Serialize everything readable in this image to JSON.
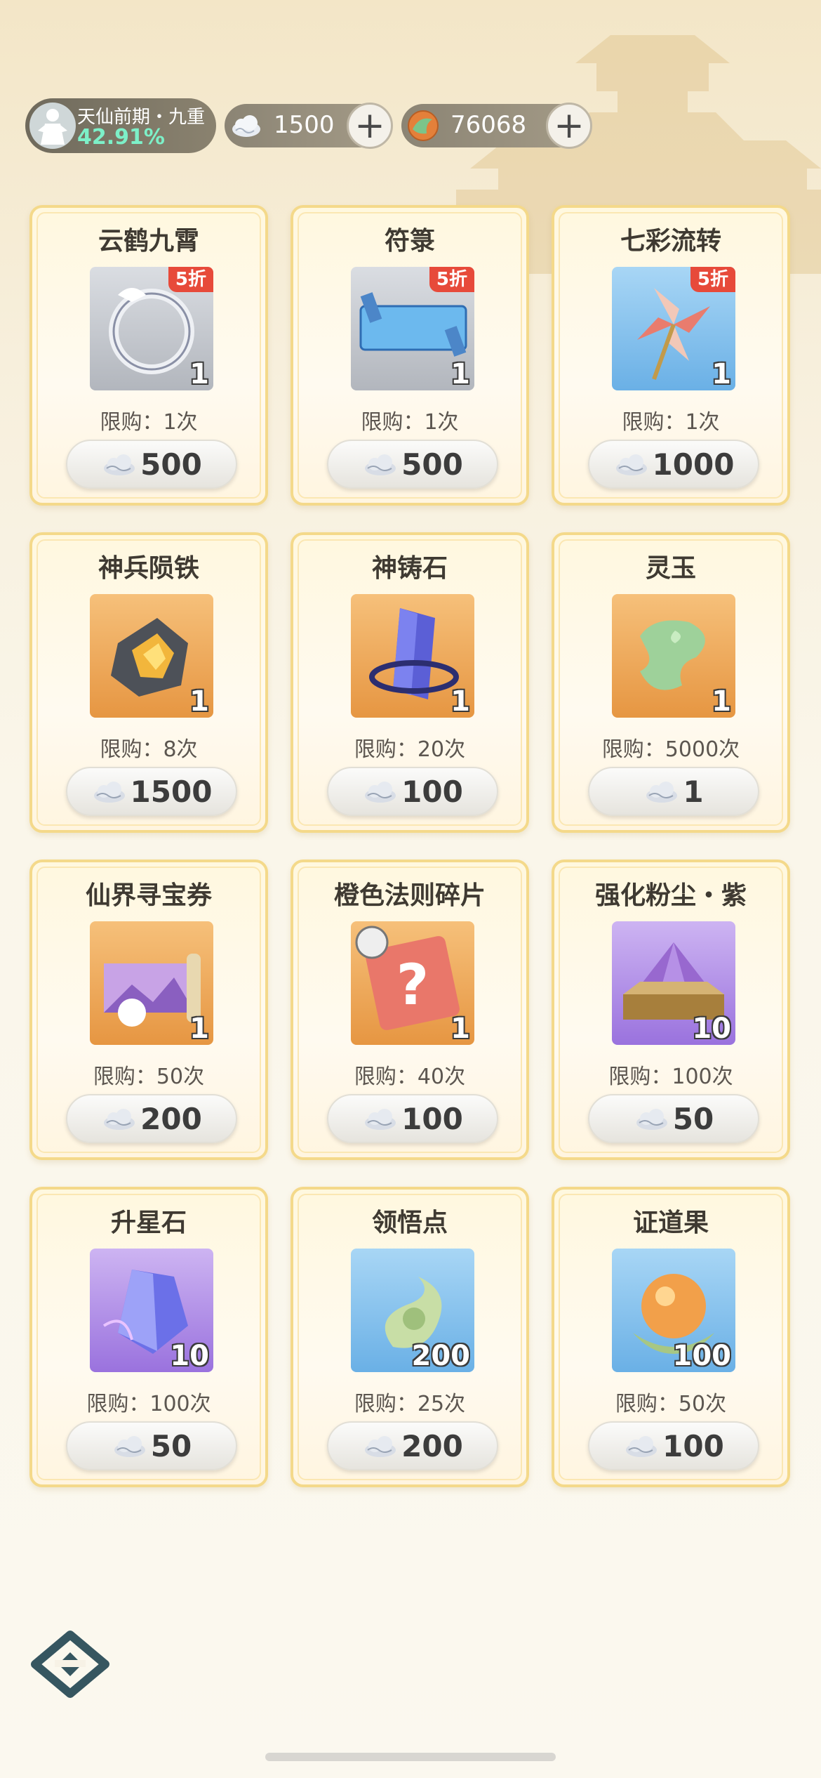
{
  "header": {
    "realm_title": "天仙前期・九重",
    "realm_progress": "42.91%",
    "currency_cloud_amount": "1500",
    "currency_jade_amount": "76068"
  },
  "items": [
    {
      "name": "云鹤九霄",
      "qty": "1",
      "limit": "限购：1次",
      "price": "500",
      "discount": "5折",
      "rarity": "gray",
      "art": "ring"
    },
    {
      "name": "符箓",
      "qty": "1",
      "limit": "限购：1次",
      "price": "500",
      "discount": "5折",
      "rarity": "gray",
      "art": "talisman"
    },
    {
      "name": "七彩流转",
      "qty": "1",
      "limit": "限购：1次",
      "price": "1000",
      "discount": "5折",
      "rarity": "blue",
      "art": "pinwheel"
    },
    {
      "name": "神兵陨铁",
      "qty": "1",
      "limit": "限购：8次",
      "price": "1500",
      "discount": "",
      "rarity": "orange",
      "art": "ore"
    },
    {
      "name": "神铸石",
      "qty": "1",
      "limit": "限购：20次",
      "price": "100",
      "discount": "",
      "rarity": "orange",
      "art": "crystal"
    },
    {
      "name": "灵玉",
      "qty": "1",
      "limit": "限购：5000次",
      "price": "1",
      "discount": "",
      "rarity": "orange",
      "art": "jade"
    },
    {
      "name": "仙界寻宝券",
      "qty": "1",
      "limit": "限购：50次",
      "price": "200",
      "discount": "",
      "rarity": "orange",
      "art": "scroll"
    },
    {
      "name": "橙色法则碎片",
      "qty": "1",
      "limit": "限购：40次",
      "price": "100",
      "discount": "",
      "rarity": "orange",
      "art": "fragment"
    },
    {
      "name": "强化粉尘・紫",
      "qty": "10",
      "limit": "限购：100次",
      "price": "50",
      "discount": "",
      "rarity": "purple",
      "art": "dust"
    },
    {
      "name": "升星石",
      "qty": "10",
      "limit": "限购：100次",
      "price": "50",
      "discount": "",
      "rarity": "purple",
      "art": "starstone"
    },
    {
      "name": "领悟点",
      "qty": "200",
      "limit": "限购：25次",
      "price": "200",
      "discount": "",
      "rarity": "blue",
      "art": "swirl"
    },
    {
      "name": "证道果",
      "qty": "100",
      "limit": "限购：50次",
      "price": "100",
      "discount": "",
      "rarity": "blue",
      "art": "fruit"
    }
  ],
  "colors": {
    "card_border": "#f4d98a",
    "discount": "#e74a3a",
    "progress": "#7df0c8"
  }
}
